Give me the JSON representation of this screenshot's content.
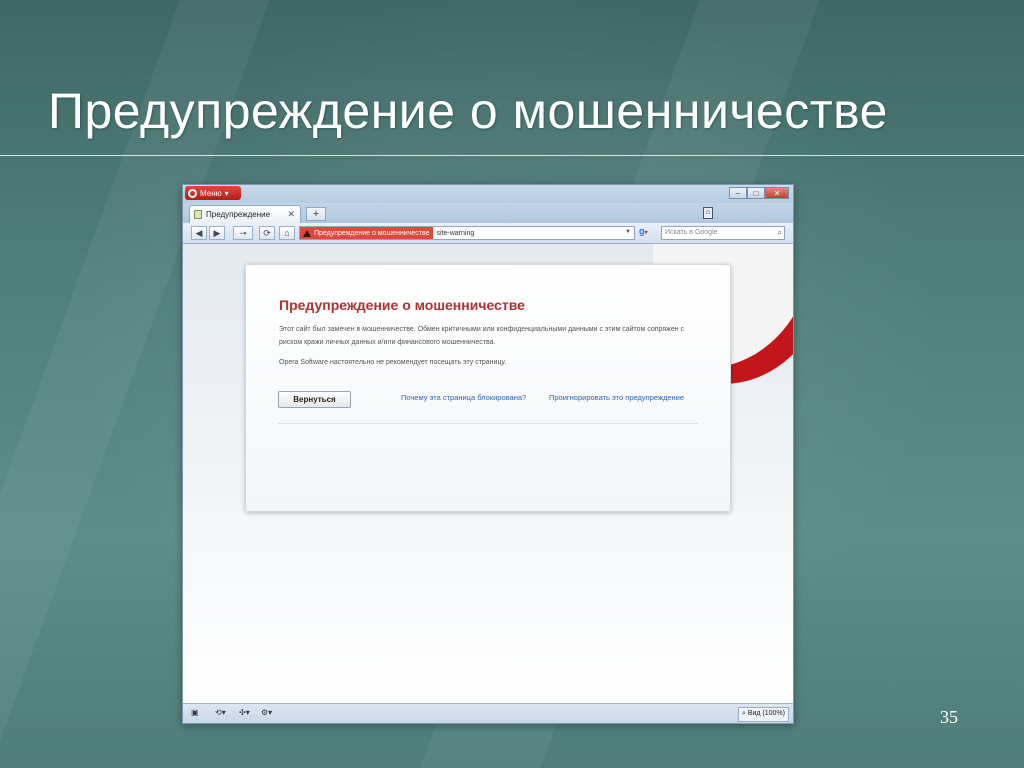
{
  "slide": {
    "title": "Предупреждение о мошенничестве",
    "page_number": "35"
  },
  "browser": {
    "menu_label": "Меню",
    "window_controls": [
      "minimize-icon",
      "restore-icon",
      "close-icon"
    ],
    "tab": {
      "label": "Предупреждение",
      "close": "✕"
    },
    "new_tab": "+",
    "address_bar": {
      "fraud_badge": "Предупреждение о мошенничестве",
      "url": "site-warning"
    },
    "search": {
      "engine": "g",
      "placeholder": "Искать в Google"
    },
    "status_bar": {
      "zoom": "Вид (100%)"
    }
  },
  "warning_page": {
    "heading": "Предупреждение о мошенничестве",
    "paragraph1": "Этот сайт был замечен в мошенничестве. Обмен критичными или конфиденциальными данными с этим сайтом сопряжен с риском кражи личных данных и/или финансового мошенничества.",
    "paragraph2": "Opera Software настоятельно не рекомендует посещать эту страницу.",
    "back_button": "Вернуться",
    "link_why": "Почему эта страница блокирована?",
    "link_ignore": "Проигнорировать это предупреждение"
  },
  "colors": {
    "opera_red": "#c2161a",
    "heading_red": "#b13030",
    "link_blue": "#2d64b8",
    "slide_bg": "#4f7f7a"
  }
}
